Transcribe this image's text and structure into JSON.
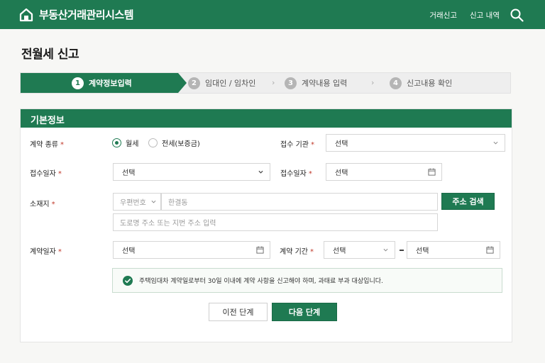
{
  "header": {
    "brand": "부동산거래관리시스템",
    "nav": [
      "거래신고",
      "신고 내역"
    ]
  },
  "page": {
    "title": "전월세 신고"
  },
  "steps": [
    {
      "num": "1",
      "label": "계약정보입력",
      "active": true
    },
    {
      "num": "2",
      "label": "임대인 / 임차인"
    },
    {
      "num": "3",
      "label": "계약내용 입력"
    },
    {
      "num": "4",
      "label": "신고내용 확인"
    }
  ],
  "form": {
    "section_title": "기본정보",
    "contract_type": {
      "label": "계약 종류",
      "options": [
        "월세",
        "전세(보증금)"
      ],
      "selected": "월세"
    },
    "agency": {
      "label": "접수 기관",
      "value": "선택"
    },
    "receipt_date_left": {
      "label": "접수일자",
      "value": "선택"
    },
    "receipt_date_right": {
      "label": "접수일자",
      "value": "선택"
    },
    "address": {
      "label": "소재지",
      "zip_select": "우편번호",
      "zip_placeholder": "한결동",
      "detail_placeholder": "도로명 주소 또는 지번 주소 입력",
      "search_button": "주소 검색"
    },
    "contract_date": {
      "label": "계약일자",
      "value": "선택"
    },
    "contract_period": {
      "label": "계약 기간",
      "start": "선택",
      "end": "선택"
    },
    "notice": "주택임대차 계약일로부터 30일 이내에 계약 사항을 신고해야 하며, 과태료 부과 대상입니다.",
    "buttons": {
      "prev": "이전 단계",
      "next": "다음 단계"
    }
  },
  "colors": {
    "primary": "#1f7a52",
    "required": "#c0392b"
  },
  "required_mark": "*"
}
